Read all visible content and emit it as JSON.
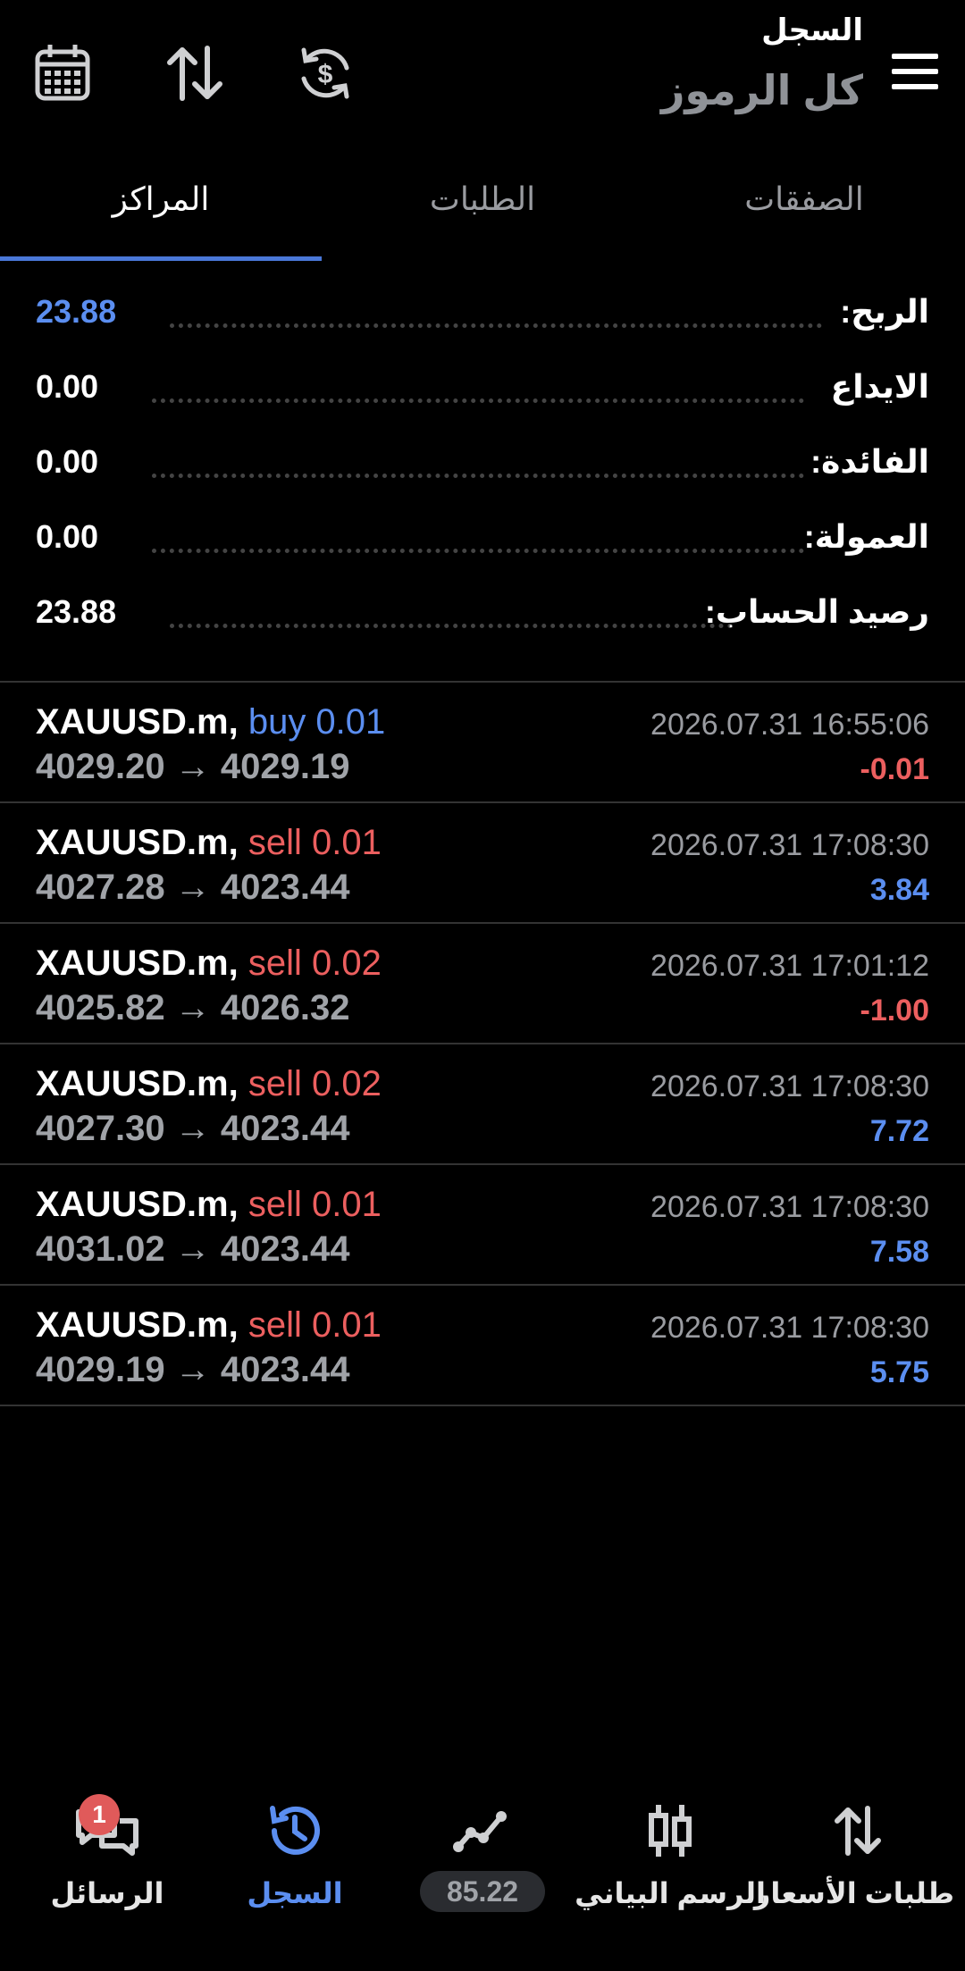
{
  "header": {
    "subtitle": "السجل",
    "title": "كل الرموز",
    "icons": [
      "calendar-icon",
      "sort-icon",
      "currency-sync-icon",
      "menu-icon"
    ]
  },
  "tabs": [
    {
      "label": "الصفقات",
      "active": false
    },
    {
      "label": "الطلبات",
      "active": false
    },
    {
      "label": "المراكز",
      "active": true
    }
  ],
  "summary": [
    {
      "label": "الربح:",
      "value": "23.88",
      "highlight": true
    },
    {
      "label": "الايداع",
      "value": "0.00",
      "highlight": false
    },
    {
      "label": "الفائدة:",
      "value": "0.00",
      "highlight": false
    },
    {
      "label": "العمولة:",
      "value": "0.00",
      "highlight": false
    },
    {
      "label": "رصيد الحساب:",
      "value": "23.88",
      "highlight": false
    }
  ],
  "trades": [
    {
      "symbol": "XAUUSD.m,",
      "side": "buy 0.01",
      "type": "buy",
      "open": "4029.20",
      "close": "4029.19",
      "time": "2026.07.31 16:55:06",
      "profit": "-0.01"
    },
    {
      "symbol": "XAUUSD.m,",
      "side": "sell 0.01",
      "type": "sell",
      "open": "4027.28",
      "close": "4023.44",
      "time": "2026.07.31 17:08:30",
      "profit": "3.84"
    },
    {
      "symbol": "XAUUSD.m,",
      "side": "sell 0.02",
      "type": "sell",
      "open": "4025.82",
      "close": "4026.32",
      "time": "2026.07.31 17:01:12",
      "profit": "-1.00"
    },
    {
      "symbol": "XAUUSD.m,",
      "side": "sell 0.02",
      "type": "sell",
      "open": "4027.30",
      "close": "4023.44",
      "time": "2026.07.31 17:08:30",
      "profit": "7.72"
    },
    {
      "symbol": "XAUUSD.m,",
      "side": "sell 0.01",
      "type": "sell",
      "open": "4031.02",
      "close": "4023.44",
      "time": "2026.07.31 17:08:30",
      "profit": "7.58"
    },
    {
      "symbol": "XAUUSD.m,",
      "side": "sell 0.01",
      "type": "sell",
      "open": "4029.19",
      "close": "4023.44",
      "time": "2026.07.31 17:08:30",
      "profit": "5.75"
    }
  ],
  "arrow": "→",
  "bottom_nav": [
    {
      "label": "الرسائل",
      "icon": "chat-icon",
      "badge": "1",
      "active": false
    },
    {
      "label": "السجل",
      "icon": "history-icon",
      "active": true
    },
    {
      "label": "",
      "icon": "trade-icon",
      "pill": "85.22",
      "active": false
    },
    {
      "label": "الرسم البياني",
      "icon": "candlestick-icon",
      "active": false
    },
    {
      "label": "طلبات الأسعار",
      "icon": "quotes-icon",
      "active": false
    }
  ],
  "colors": {
    "accent": "#5b8ef0",
    "loss": "#ec5f5f",
    "background": "#000000"
  }
}
